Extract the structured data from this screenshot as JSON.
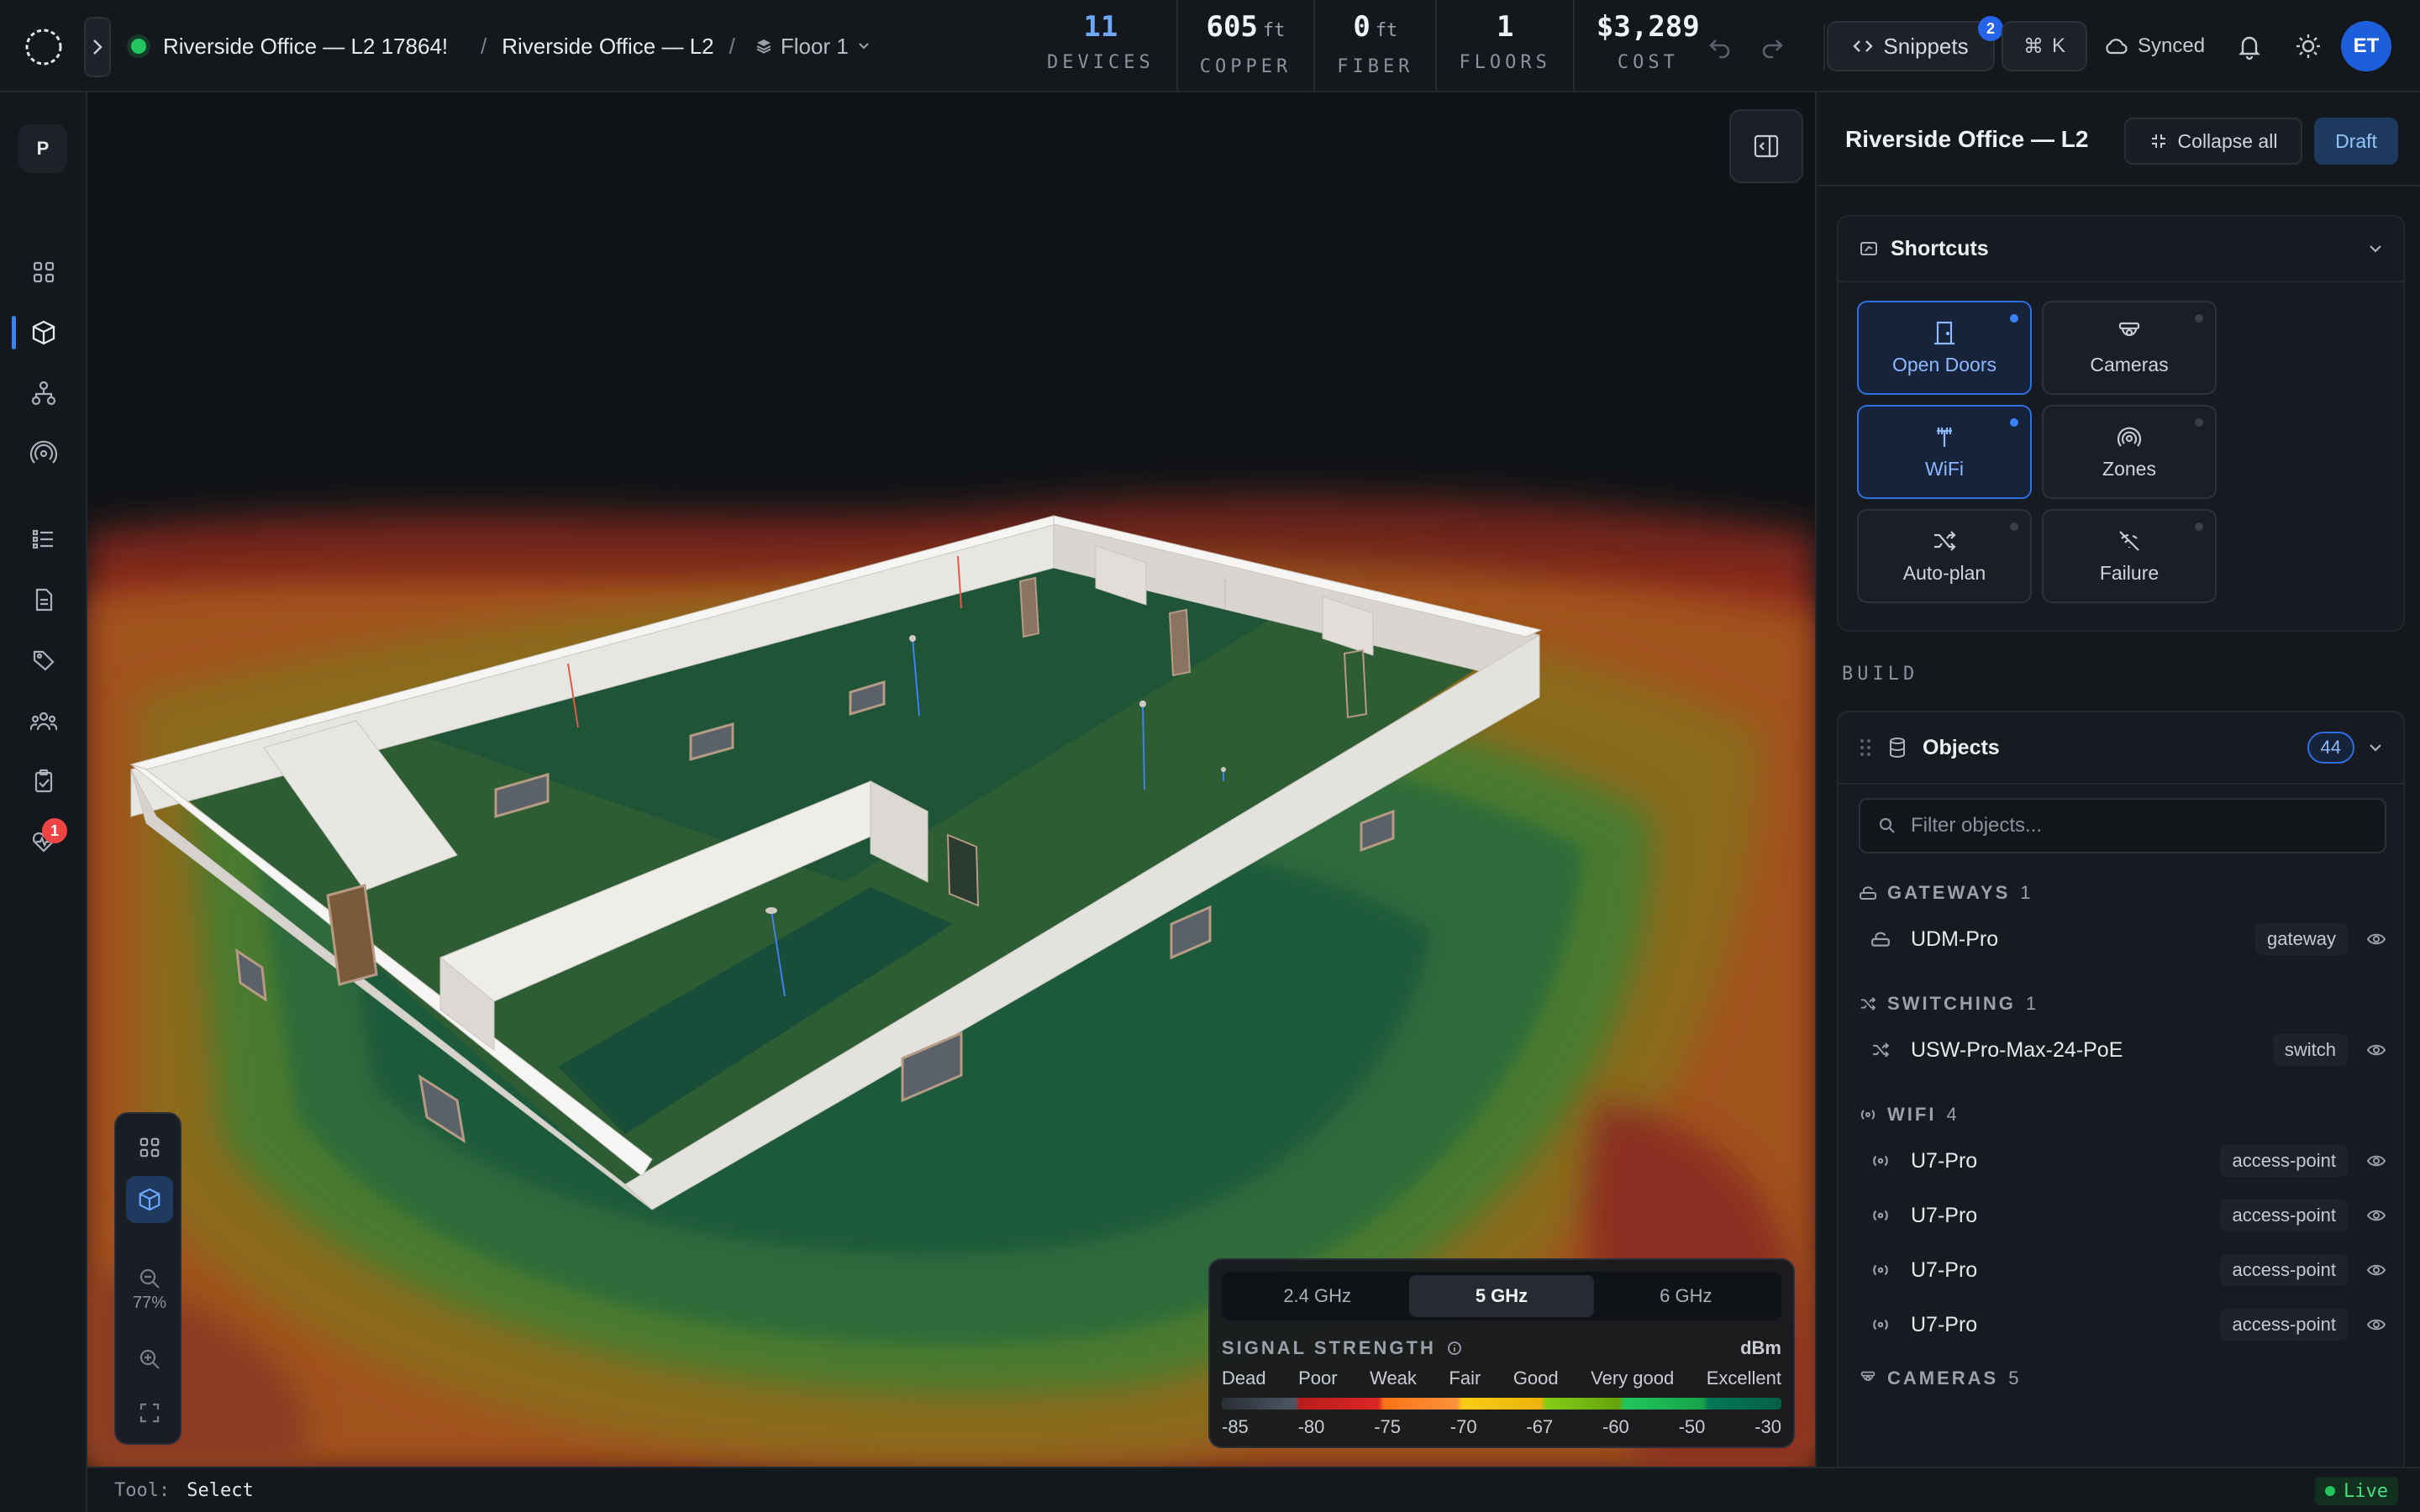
{
  "breadcrumb": {
    "project": "Riverside Office — L2 17864!",
    "plan": "Riverside Office — L2",
    "floor": "Floor 1"
  },
  "stats": [
    {
      "value": "11",
      "unit": "",
      "label": "DEVICES"
    },
    {
      "value": "605",
      "unit": "ft",
      "label": "COPPER"
    },
    {
      "value": "0",
      "unit": "ft",
      "label": "FIBER"
    },
    {
      "value": "1",
      "unit": "",
      "label": "FLOORS"
    },
    {
      "value": "$3,289",
      "unit": "",
      "label": "COST"
    }
  ],
  "toolbar": {
    "snippets_label": "Snippets",
    "snippets_badge": "2",
    "command_key": "K",
    "sync_status": "Synced",
    "avatar_initials": "ET"
  },
  "rail": {
    "project_initial": "P",
    "alerts_badge": "1"
  },
  "viewport": {
    "zoom": "77%",
    "tool_label": "Tool:",
    "tool_value": "Select",
    "live_label": "Live"
  },
  "signal_legend": {
    "bands": [
      "2.4 GHz",
      "5 GHz",
      "6 GHz"
    ],
    "active_band": "5 GHz",
    "title": "SIGNAL STRENGTH",
    "unit": "dBm",
    "quality_labels": [
      "Dead",
      "Poor",
      "Weak",
      "Fair",
      "Good",
      "Very good",
      "Excellent"
    ],
    "ticks": [
      "-85",
      "-80",
      "-75",
      "-70",
      "-67",
      "-60",
      "-50",
      "-30"
    ]
  },
  "panel": {
    "title": "Riverside Office — L2",
    "collapse_all": "Collapse all",
    "status": "Draft",
    "shortcuts": {
      "title": "Shortcuts",
      "items": [
        {
          "label": "Open Doors",
          "icon": "door-icon",
          "active": true
        },
        {
          "label": "Cameras",
          "icon": "camera-icon",
          "active": false
        },
        {
          "label": "WiFi",
          "icon": "antenna-icon",
          "active": true
        },
        {
          "label": "Zones",
          "icon": "zones-icon",
          "active": false
        },
        {
          "label": "Auto-plan",
          "icon": "shuffle-icon",
          "active": false
        },
        {
          "label": "Failure",
          "icon": "wifi-off-icon",
          "active": false
        }
      ]
    },
    "build_label": "BUILD",
    "objects": {
      "title": "Objects",
      "count": "44",
      "filter_placeholder": "Filter objects...",
      "groups": [
        {
          "name": "GATEWAYS",
          "count": "1",
          "items": [
            {
              "name": "UDM-Pro",
              "tag": "gateway"
            }
          ]
        },
        {
          "name": "SWITCHING",
          "count": "1",
          "items": [
            {
              "name": "USW-Pro-Max-24-PoE",
              "tag": "switch"
            }
          ]
        },
        {
          "name": "WIFI",
          "count": "4",
          "items": [
            {
              "name": "U7-Pro",
              "tag": "access-point"
            },
            {
              "name": "U7-Pro",
              "tag": "access-point"
            },
            {
              "name": "U7-Pro",
              "tag": "access-point"
            },
            {
              "name": "U7-Pro",
              "tag": "access-point"
            }
          ]
        },
        {
          "name": "CAMERAS",
          "count": "5",
          "items": []
        }
      ]
    }
  },
  "colors": {
    "accent": "#3b82f6",
    "status_online": "#22c55e",
    "heat_dead": "#3a3f48",
    "heat_poor": "#b91c1c",
    "heat_weak": "#f97316",
    "heat_fair": "#eab308",
    "heat_good": "#84cc16",
    "heat_excellent": "#065f46"
  }
}
